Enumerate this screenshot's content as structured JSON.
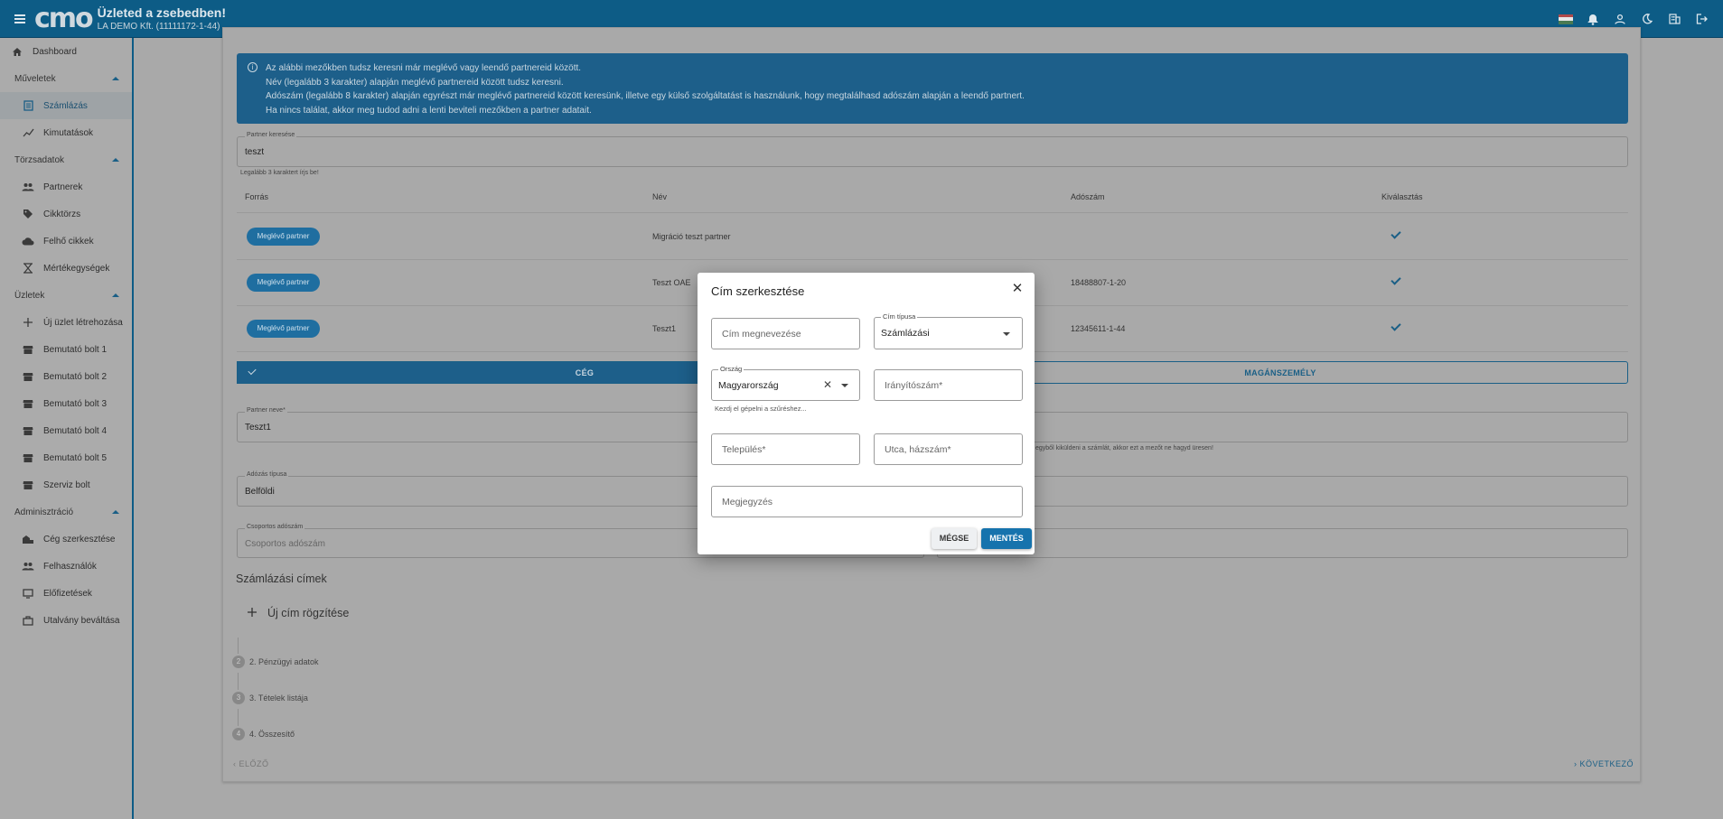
{
  "header": {
    "logo": "cmo",
    "title": "Üzleted a zsebedben!",
    "company": "LA DEMO Kft. (11111172-1-44)",
    "icons": [
      "hungarian-flag-icon",
      "bell-icon",
      "user-icon",
      "moon-icon",
      "building-icon",
      "logout-icon"
    ]
  },
  "sidebar": {
    "dashboard": "Dashboard",
    "sections": [
      {
        "title": "Műveletek",
        "items": [
          "Számlázás",
          "Kimutatások"
        ]
      },
      {
        "title": "Törzsadatok",
        "items": [
          "Partnerek",
          "Cikktörzs",
          "Felhő cikkek",
          "Mértékegységek"
        ]
      },
      {
        "title": "Üzletek",
        "items": [
          "Új üzlet létrehozása",
          "Bemutató bolt 1",
          "Bemutató bolt 2",
          "Bemutató bolt 3",
          "Bemutató bolt 4",
          "Bemutató bolt 5",
          "Szerviz bolt"
        ]
      },
      {
        "title": "Adminisztráció",
        "items": [
          "Cég szerkesztése",
          "Felhasználók",
          "Előfizetések",
          "Utalvány beváltása"
        ]
      }
    ]
  },
  "page": {
    "info_lines": [
      "Az alábbi mezőkben tudsz keresni már meglévő vagy leendő partnereid között.",
      "Név (legalább 3 karakter) alapján meglévő partnereid között tudsz keresni.",
      "Adószám (legalább 8 karakter) alapján egyrészt már meglévő partnereid között keresünk, illetve egy külső szolgáltatást is használunk, hogy megtalálhasd adószám alapján a leendő partnert.",
      "Ha nincs találat, akkor meg tudod adni a lenti beviteli mezőkben a partner adatait."
    ],
    "search": {
      "label": "Partner keresése",
      "value": "teszt",
      "hint": "Legalább 3 karaktert írjs be!"
    },
    "table": {
      "headers": [
        "Forrás",
        "Név",
        "Adószám",
        "Kiválasztás"
      ],
      "rows": [
        {
          "source": "Meglévő partner",
          "name": "Migráció teszt partner",
          "tax": ""
        },
        {
          "source": "Meglévő partner",
          "name": "Teszt OAE",
          "tax": "18488807-1-20"
        },
        {
          "source": "Meglévő partner",
          "name": "Teszt1",
          "tax": "12345611-1-44"
        }
      ]
    },
    "seg_company": "CÉG",
    "seg_private": "MAGÁNSZEMÉLY",
    "partner_name": {
      "label": "Partner neve*",
      "value": "Teszt1"
    },
    "partner_hint": "egyből kiküldeni a számlát, akkor ezt a mezőt ne hagyd üresen!",
    "tax_type": {
      "label": "Adózás típusa",
      "value": "Belföldi"
    },
    "group_tax": {
      "label": "Csoportos adószám",
      "placeholder": "Csoportos adószám"
    },
    "billing_title": "Számlázási címek",
    "new_address": "Új cím rögzítése",
    "steps": [
      {
        "n": "2",
        "label": "2. Pénzügyi adatok"
      },
      {
        "n": "3",
        "label": "3. Tételek listája"
      },
      {
        "n": "4",
        "label": "4. Összesítő"
      }
    ],
    "prev": "ELŐZŐ",
    "next": "KÖVETKEZŐ"
  },
  "modal": {
    "title": "Cím szerkesztése",
    "name_placeholder": "Cím megnevezése",
    "type_label": "Cím típusa",
    "type_value": "Számlázási",
    "country_label": "Ország",
    "country_value": "Magyarország",
    "country_hint": "Kezdj el gépelni a szűréshez...",
    "zip_placeholder": "Irányítószám*",
    "city_placeholder": "Település*",
    "street_placeholder": "Utca, házszám*",
    "note_placeholder": "Megjegyzés",
    "cancel": "MÉGSE",
    "save": "MENTÉS"
  },
  "colors": {
    "topbar": "#0d5c86",
    "info": "#1d5f8a",
    "accent": "#1673ad",
    "overlay": "#a9a9a9"
  }
}
